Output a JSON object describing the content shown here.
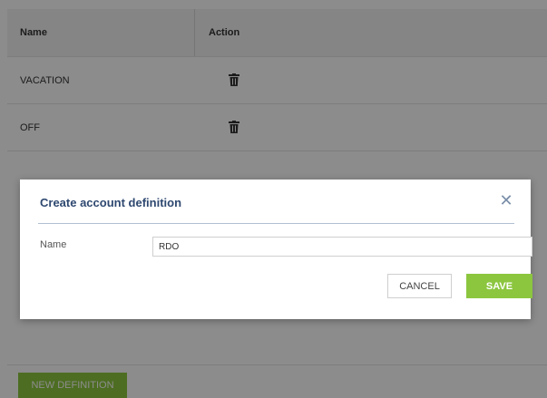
{
  "table": {
    "headers": {
      "name": "Name",
      "action": "Action"
    },
    "rows": [
      {
        "name": "VACATION",
        "action_icon": "trash-icon"
      },
      {
        "name": "OFF",
        "action_icon": "trash-icon"
      }
    ]
  },
  "footer": {
    "new_definition_label": "NEW DEFINITION"
  },
  "modal": {
    "title": "Create account definition",
    "close_icon": "close-icon",
    "name_label": "Name",
    "name_value": "RDO",
    "cancel_label": "CANCEL",
    "save_label": "SAVE"
  },
  "colors": {
    "accent_green": "#8cc63f",
    "title_blue": "#2e4870",
    "overlay": "rgba(0,0,0,0.45)"
  }
}
